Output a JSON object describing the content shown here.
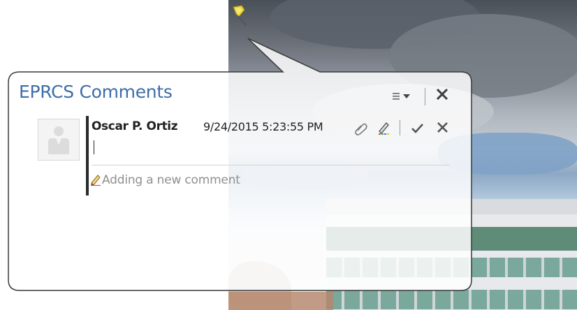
{
  "panel": {
    "title": "EPRCS Comments",
    "menu_symbol": "≡▾",
    "close_symbol": "✕"
  },
  "comment": {
    "author": "Oscar P. Ortiz",
    "timestamp": "9/24/2015 5:23:55 PM",
    "input_value": "",
    "status_text": "Adding a new comment"
  },
  "icons": {
    "pin": "pushpin-icon",
    "attach": "paperclip-icon",
    "markup": "pen-highlight-icon",
    "confirm": "checkmark-icon",
    "cancel": "close-icon",
    "avatar": "user-avatar-icon",
    "status": "pencil-icon"
  },
  "colors": {
    "title": "#3d6ea8",
    "pin": "#e8d23a",
    "status_text": "#8f8f8f"
  }
}
